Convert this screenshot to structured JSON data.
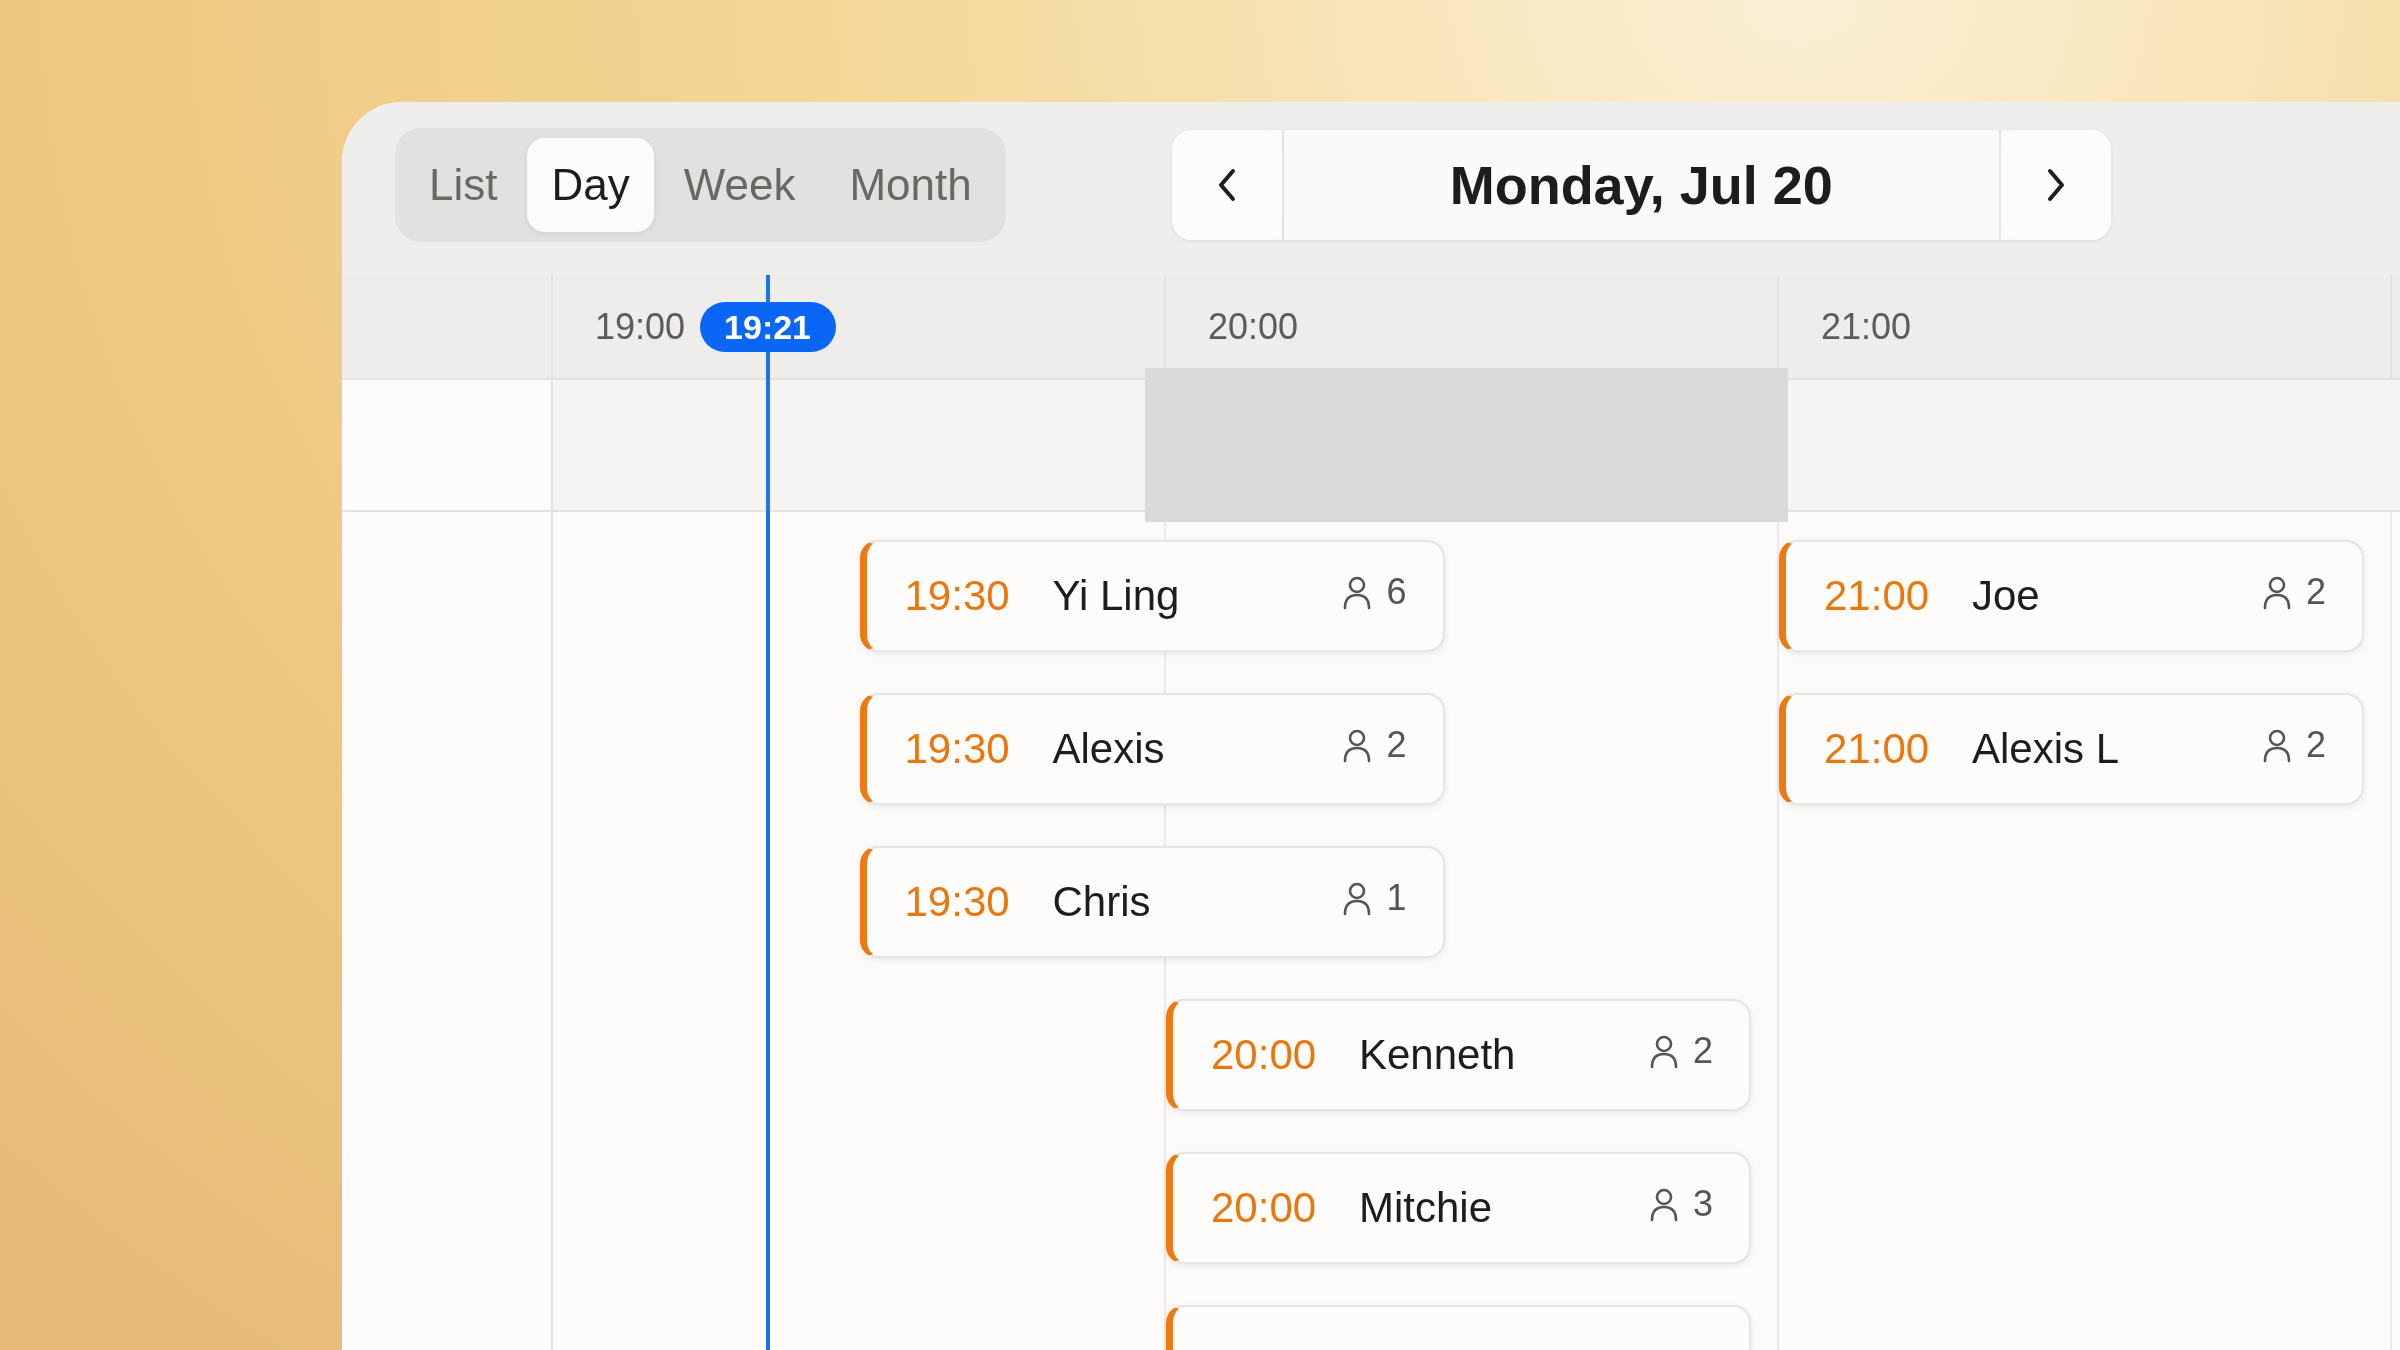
{
  "view_tabs": [
    {
      "label": "List",
      "selected": false
    },
    {
      "label": "Day",
      "selected": true
    },
    {
      "label": "Week",
      "selected": false
    },
    {
      "label": "Month",
      "selected": false
    }
  ],
  "date_nav": {
    "label": "Monday, Jul 20"
  },
  "hours": [
    {
      "label": "19:00",
      "blocked": false
    },
    {
      "label": "20:00",
      "blocked": true
    },
    {
      "label": "21:00",
      "blocked": false
    }
  ],
  "now": "19:21",
  "bookings": [
    {
      "kind": "booking",
      "time": "19:30",
      "name": "Yi Ling",
      "guests": "6"
    },
    {
      "kind": "booking",
      "time": "19:30",
      "name": "Alexis",
      "guests": "2"
    },
    {
      "kind": "booking",
      "time": "19:30",
      "name": "Chris",
      "guests": "1"
    },
    {
      "kind": "booking",
      "time": "20:00",
      "name": "Kenneth",
      "guests": "2"
    },
    {
      "kind": "booking",
      "time": "20:00",
      "name": "Mitchie",
      "guests": "3"
    },
    {
      "kind": "clipped"
    },
    {
      "kind": "booking",
      "time": "21:00",
      "name": "Joe",
      "guests": "2"
    },
    {
      "kind": "booking",
      "time": "21:00",
      "name": "Alexis L",
      "guests": "2"
    }
  ]
}
